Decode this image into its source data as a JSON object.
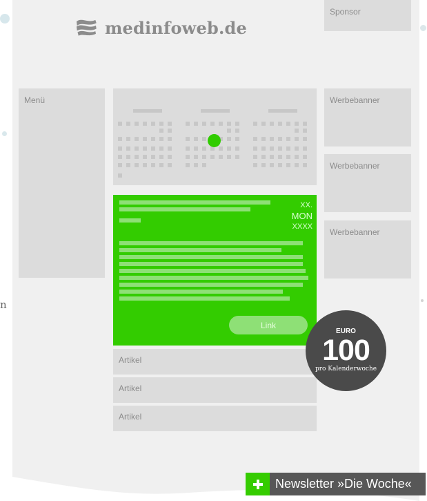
{
  "header": {
    "logo_text": "medinfoweb.de",
    "logo_icon": "wave-logo-icon",
    "sponsor_label": "Sponsor"
  },
  "sidebar": {
    "menu_label": "Menü"
  },
  "banners": [
    {
      "label": "Werbebanner"
    },
    {
      "label": "Werbebanner"
    },
    {
      "label": "Werbebanner"
    }
  ],
  "feature_ad": {
    "date_line1": "XX.",
    "date_line2": "MON",
    "date_line3": "XXXX",
    "link_label": "Link"
  },
  "articles": [
    {
      "label": "Artikel"
    },
    {
      "label": "Artikel"
    },
    {
      "label": "Artikel"
    }
  ],
  "price_badge": {
    "currency": "EURO",
    "value": "100",
    "unit": "pro Kalenderwoche"
  },
  "newsletter": {
    "label": "Newsletter »Die Woche«",
    "icon": "plus-icon"
  },
  "side_fragment": {
    "text": "n"
  },
  "colors": {
    "accent_green": "#33cc00",
    "light_green": "#8ee076",
    "placeholder_gray": "#dcdcdc",
    "dark_gray": "#575757"
  }
}
